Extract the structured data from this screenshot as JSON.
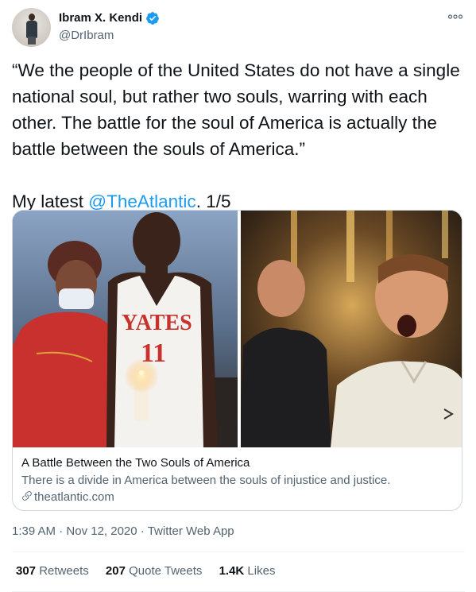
{
  "author": {
    "name": "Ibram X. Kendi",
    "handle": "@DrIbram",
    "verified_icon": "verified-badge-icon",
    "more_icon": "more-options-icon"
  },
  "tweet": {
    "quote_text": "“We the people of the United States do not have a single national soul, but rather two souls, warring with each other. The battle for the soul of America is actually the battle between the souls of America.”",
    "latest_prefix": "My latest ",
    "mention": "@TheAtlantic",
    "latest_suffix": ". 1/5"
  },
  "card": {
    "title": "A Battle Between the Two Souls of America",
    "description": "There is a divide in America between the souls of injustice and justice.",
    "domain": "theatlantic.com",
    "jersey_text": "YATES",
    "jersey_number": "11"
  },
  "meta": {
    "time": "1:39 AM",
    "date": "Nov 12, 2020",
    "source": "Twitter Web App",
    "separator": " · "
  },
  "stats": {
    "retweets_count": "307",
    "retweets_label": "Retweets",
    "quotes_count": "207",
    "quotes_label": "Quote Tweets",
    "likes_count": "1.4K",
    "likes_label": "Likes"
  },
  "colors": {
    "link": "#1d9bf0",
    "secondary_text": "#536471",
    "primary_text": "#0f1419"
  }
}
